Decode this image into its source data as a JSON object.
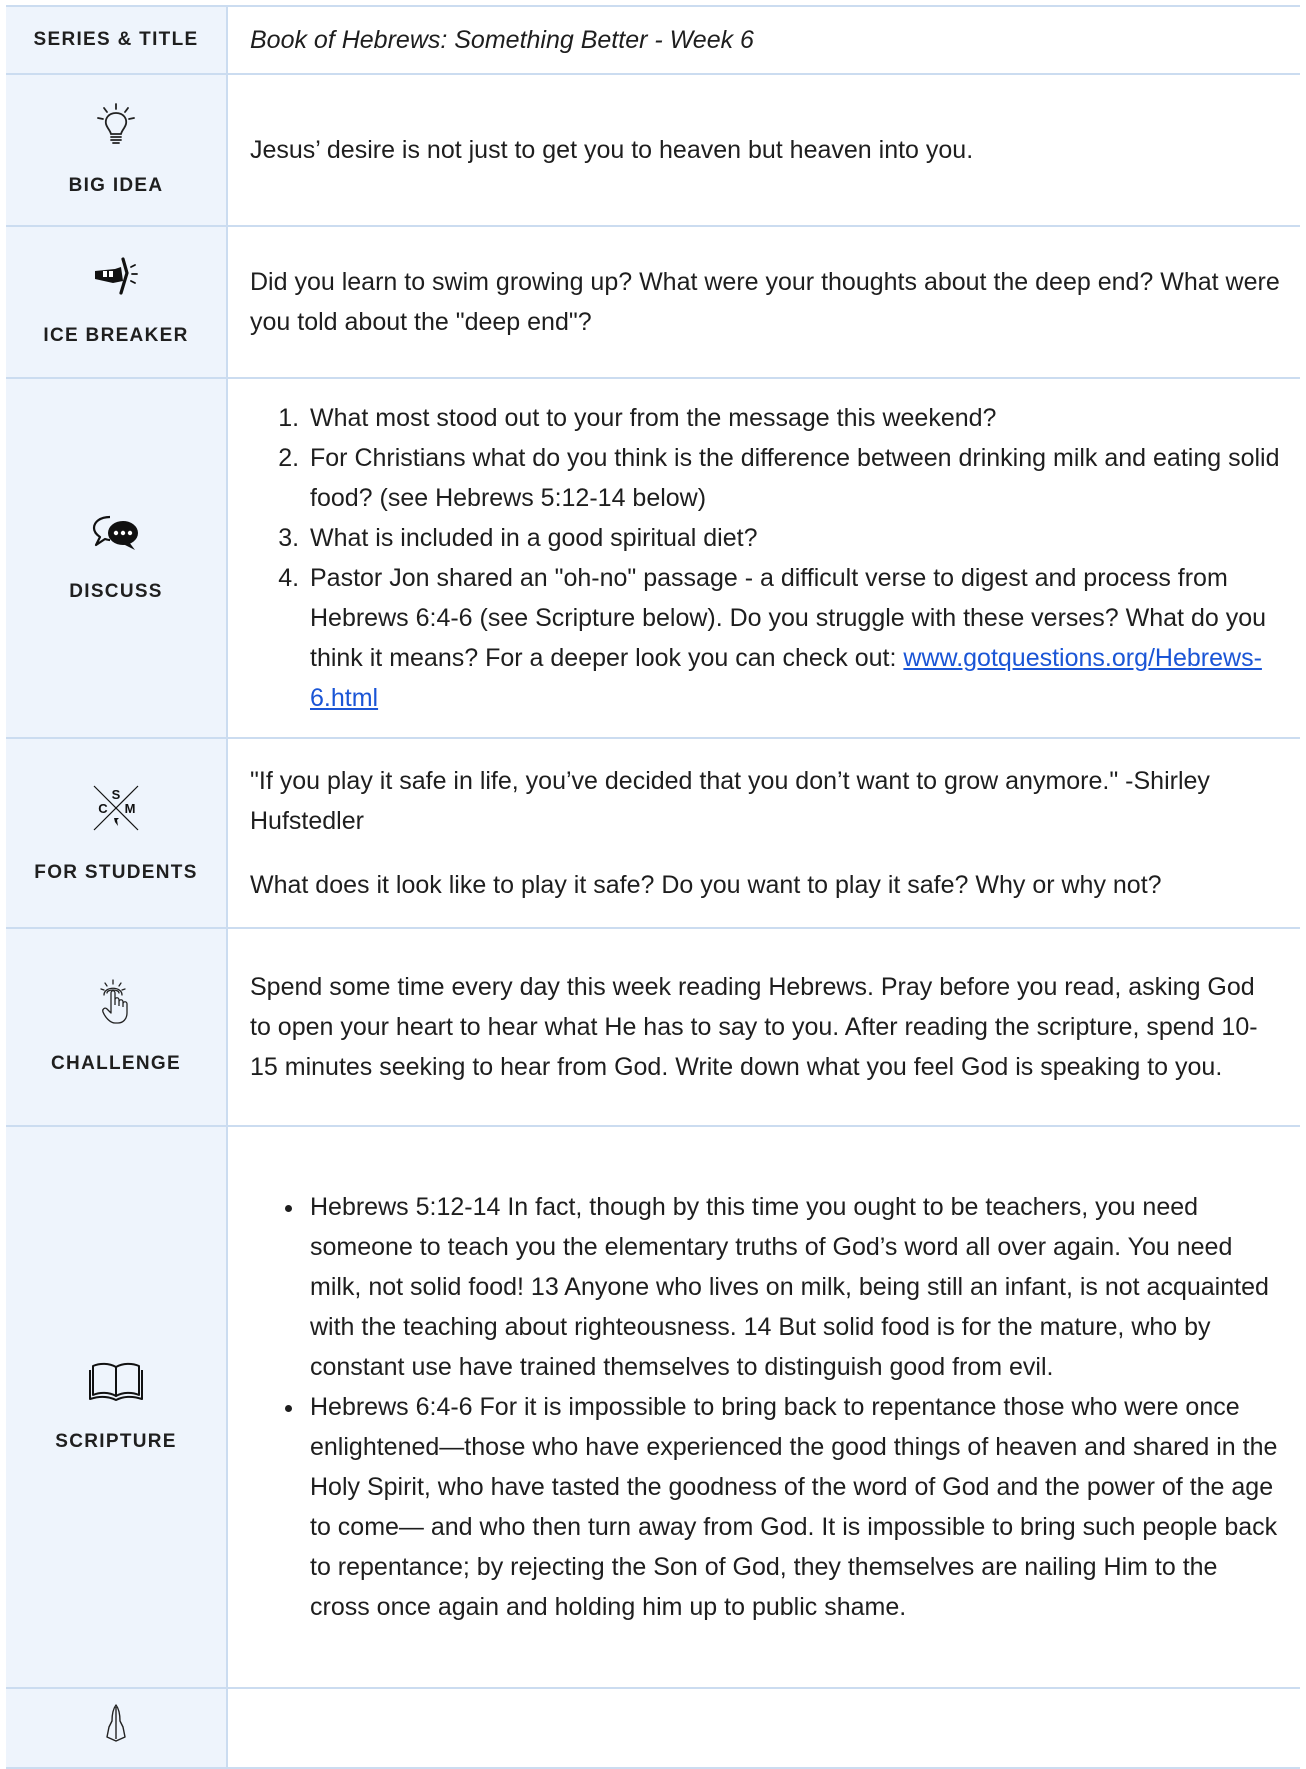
{
  "series": {
    "label": "SERIES & TITLE",
    "text": "Book of Hebrews: Something Better - Week 6"
  },
  "big_idea": {
    "label": "BIG IDEA",
    "icon": "lightbulb-icon",
    "text": "Jesus’ desire is not just to get you to heaven but heaven into you."
  },
  "ice_breaker": {
    "label": "ICE BREAKER",
    "icon": "ice-pick-icon",
    "text": "Did you learn to swim growing up? What were your thoughts about the deep end? What were you told about the \"deep end\"?"
  },
  "discuss": {
    "label": "DISCUSS",
    "icon": "speech-bubbles-icon",
    "items": [
      "What most stood out to your from the message this weekend?",
      "For Christians what do you think is the difference between drinking milk and eating solid food? (see Hebrews 5:12-14 below)",
      "What is included in a good spiritual diet?",
      "Pastor Jon shared an \"oh-no\" passage - a difficult verse to digest and process from Hebrews 6:4-6 (see Scripture below). Do you struggle with these verses? What do you think it means? For a deeper look you can check out:"
    ],
    "link": "www.gotquestions.org/Hebrews-6.html"
  },
  "for_students": {
    "label": "FOR STUDENTS",
    "icon": "csm-logo-icon",
    "logo_letters": [
      "S",
      "C",
      "M"
    ],
    "quote": "\"If you play it safe in life, you’ve decided that you don’t want to grow anymore.\" -Shirley Hufstedler",
    "question": "What does it look like to play it safe? Do you want to play it safe? Why or why not?"
  },
  "challenge": {
    "label": "CHALLENGE",
    "icon": "hand-tap-icon",
    "text": "Spend some time every day this week reading Hebrews. Pray before you read, asking God to open your heart to hear what He has to say to you. After reading the scripture, spend 10-15 minutes seeking to hear from God. Write down what you feel God is speaking to you."
  },
  "scripture": {
    "label": "SCRIPTURE",
    "icon": "open-book-icon",
    "items": [
      "Hebrews 5:12-14 In fact, though by this time you ought to be teachers, you need someone to teach you the elementary truths of God’s word all over again. You need milk, not solid food! 13 Anyone who lives on milk, being still an infant, is not acquainted with the teaching about righteousness. 14 But solid food is for the mature, who by constant use have trained themselves to distinguish good from evil.",
      "Hebrews 6:4-6 For it is impossible to bring back to repentance those who were once enlightened—those who have experienced the good things of heaven and shared in the Holy Spirit, who have tasted the goodness of the word of God and the power of the age to come— and who then turn away from God. It is impossible to bring such people back to repentance; by rejecting the Son of God, they themselves are nailing Him to the cross once again and holding him up to public shame."
    ]
  },
  "prayer": {
    "icon": "praying-hands-icon"
  },
  "colors": {
    "label_bg": "#eef4fc",
    "border": "#cbdcf0",
    "link": "#1a55d6",
    "text": "#1e1e1e"
  }
}
